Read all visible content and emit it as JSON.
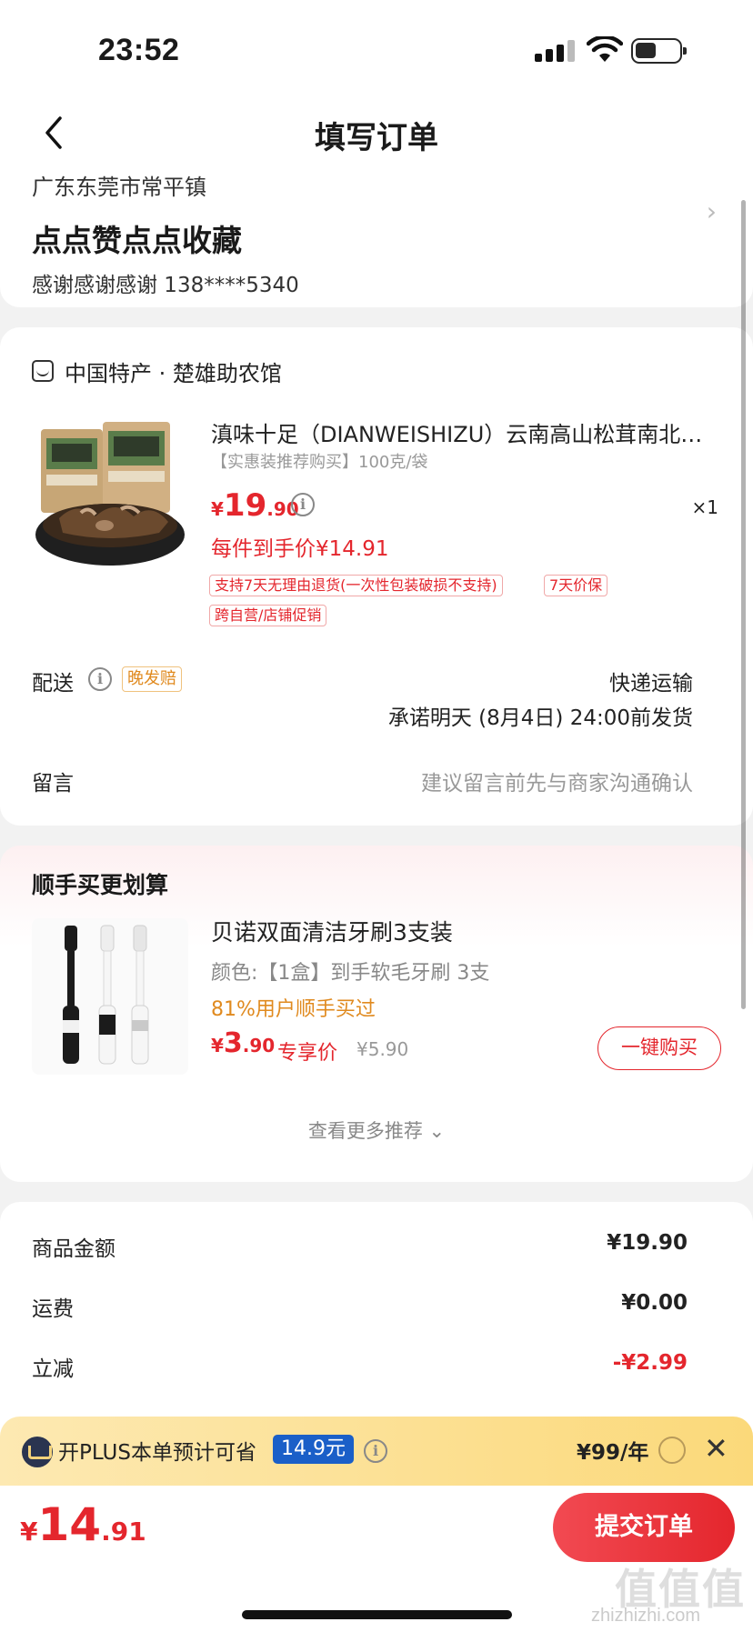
{
  "status_bar": {
    "time": "23:52"
  },
  "nav": {
    "title": "填写订单"
  },
  "address": {
    "region": "广东东莞市常平镇",
    "name": "点点赞点点收藏",
    "contact": "感谢感谢感谢 138****5340"
  },
  "order": {
    "shop_name": "中国特产 · 楚雄助农馆",
    "product": {
      "title": "滇味十足（DIANWEISHIZU）云南高山松茸南北…",
      "spec": "【实惠装推荐购买】100克/袋",
      "price_currency": "¥",
      "price_int": "19",
      "price_dec": ".90",
      "quantity": "×1",
      "net_price": "每件到手价¥14.91",
      "tags": [
        "支持7天无理由退货(一次性包装破损不支持)",
        "7天价保",
        "跨自营/店铺促销"
      ]
    },
    "shipping": {
      "label": "配送",
      "late_tag": "晚发赔",
      "method": "快递运输",
      "promise": "承诺明天 (8月4日) 24:00前发货"
    },
    "note": {
      "label": "留言",
      "placeholder": "建议留言前先与商家沟通确认"
    }
  },
  "upsell": {
    "title": "顺手买更划算",
    "product": {
      "name": "贝诺双面清洁牙刷3支装",
      "spec": "颜色:【1盒】到手软毛牙刷 3支",
      "bought": "81%用户顺手买过",
      "price_currency": "¥",
      "price_int": "3",
      "price_dec": ".90",
      "price_label": "专享价",
      "original_price": "¥5.90",
      "buy_label": "一键购买"
    },
    "more_label": "查看更多推荐 ⌄"
  },
  "summary": {
    "rows": [
      {
        "label": "商品金额",
        "value": "¥19.90"
      },
      {
        "label": "运费",
        "value": "¥0.00"
      },
      {
        "label": "立减",
        "value": "-¥2.99"
      }
    ]
  },
  "plus": {
    "text": "开PLUS本单预计可省",
    "amount": "14.9元",
    "price": "¥99/年"
  },
  "footer": {
    "total_currency": "¥",
    "total_int": "14",
    "total_dec": ".91",
    "submit_label": "提交订单"
  },
  "watermark": {
    "text": "zhizhizhi.com",
    "big": "值值值"
  },
  "colors": {
    "accent_red": "#e4262d",
    "plus_blue": "#1a5fc8",
    "orange": "#e08a1f"
  }
}
